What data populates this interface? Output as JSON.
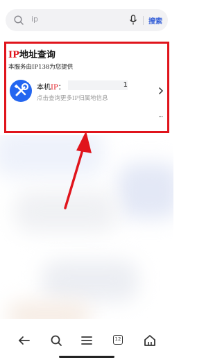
{
  "search": {
    "query": "ip",
    "button_label": "搜索"
  },
  "ip_card": {
    "title_prefix": "IP",
    "title_rest": "地址查询",
    "provider": "本服务由IP138为您提供",
    "ip_label_prefix": "本机",
    "ip_label_red": "IP",
    "ip_label_colon": "：",
    "ip_value": "1",
    "hint": "点击查询更多IP归属地信息",
    "more": "···"
  },
  "bottom_nav": {
    "tab_count": "12"
  },
  "colors": {
    "highlight_red": "#e0141c",
    "brand_blue": "#2466f0",
    "search_blue": "#2f5bd6"
  },
  "icons": [
    "search-icon",
    "mic-icon",
    "wrench-screwdriver-icon",
    "chevron-right-icon",
    "back-arrow-icon",
    "menu-icon",
    "tabs-icon",
    "home-icon"
  ]
}
